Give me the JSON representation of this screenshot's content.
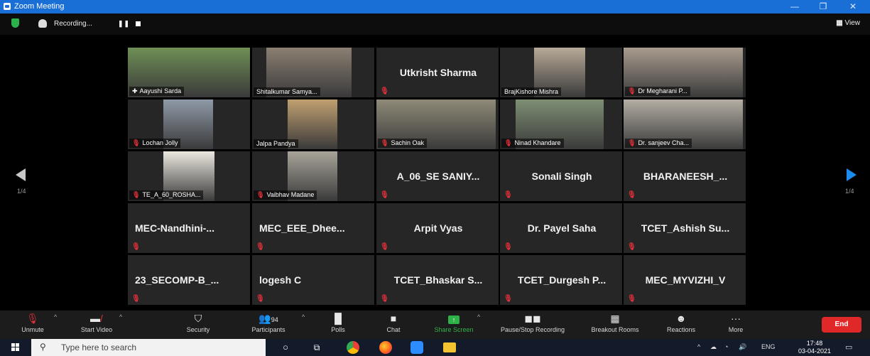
{
  "window": {
    "title": "Zoom Meeting",
    "minimize": "—",
    "restore": "❐",
    "close": "✕"
  },
  "topbar": {
    "recording_text": "Recording...",
    "pause_label": "❚❚",
    "view_label": "View"
  },
  "pagination": {
    "left_page": "1/4",
    "right_page": "1/4"
  },
  "participants": [
    {
      "name": "Aayushi Sarda",
      "video": true,
      "muted": false,
      "pinned": true,
      "active": true
    },
    {
      "name": "Shitalkumar Samya...",
      "video": true,
      "muted": false
    },
    {
      "name": "Utkrisht Sharma",
      "video": false,
      "muted": true
    },
    {
      "name": "BrajKishore Mishra",
      "video": true,
      "muted": false
    },
    {
      "name": "Dr Megharani P...",
      "video": true,
      "muted": true
    },
    {
      "name": "Lochan Jolly",
      "video": true,
      "muted": true
    },
    {
      "name": "Jalpa Pandya",
      "video": true,
      "muted": false
    },
    {
      "name": "Sachin Oak",
      "video": true,
      "muted": true
    },
    {
      "name": "Ninad Khandare",
      "video": true,
      "muted": true
    },
    {
      "name": "Dr. sanjeev Cha...",
      "video": true,
      "muted": true
    },
    {
      "name": "TE_A_60_ROSHA...",
      "video": true,
      "muted": true
    },
    {
      "name": "Vaibhav Madane",
      "video": true,
      "muted": true
    },
    {
      "name": "A_06_SE SANIY...",
      "video": false,
      "muted": true
    },
    {
      "name": "Sonali Singh",
      "video": false,
      "muted": true
    },
    {
      "name": "BHARANEESH_...",
      "video": false,
      "muted": true
    },
    {
      "name": "MEC-Nandhini-...",
      "video": false,
      "muted": true
    },
    {
      "name": "MEC_EEE_Dhee...",
      "video": false,
      "muted": true
    },
    {
      "name": "Arpit Vyas",
      "video": false,
      "muted": true
    },
    {
      "name": "Dr. Payel Saha",
      "video": false,
      "muted": true
    },
    {
      "name": "TCET_Ashish Su...",
      "video": false,
      "muted": true
    },
    {
      "name": "23_SECOMP-B_...",
      "video": false,
      "muted": true
    },
    {
      "name": "logesh C",
      "video": false,
      "muted": true
    },
    {
      "name": "TCET_Bhaskar S...",
      "video": false,
      "muted": true
    },
    {
      "name": "TCET_Durgesh P...",
      "video": false,
      "muted": true
    },
    {
      "name": "MEC_MYVIZHI_V",
      "video": false,
      "muted": true
    }
  ],
  "toolbar": {
    "unmute": "Unmute",
    "start_video": "Start Video",
    "security": "Security",
    "participants": "Participants",
    "participants_count": "94",
    "polls": "Polls",
    "chat": "Chat",
    "share_screen": "Share Screen",
    "pause_stop_recording": "Pause/Stop Recording",
    "breakout_rooms": "Breakout Rooms",
    "reactions": "Reactions",
    "more": "More",
    "end": "End"
  },
  "taskbar": {
    "search_placeholder": "Type here to search",
    "language": "ENG",
    "time": "17:48",
    "date": "03-04-2021"
  },
  "colors": {
    "title_blue": "#1a6fd6",
    "end_red": "#e02828",
    "share_green": "#2fb14a",
    "active_border": "#b6d22a",
    "mute_red": "#e0303a"
  }
}
